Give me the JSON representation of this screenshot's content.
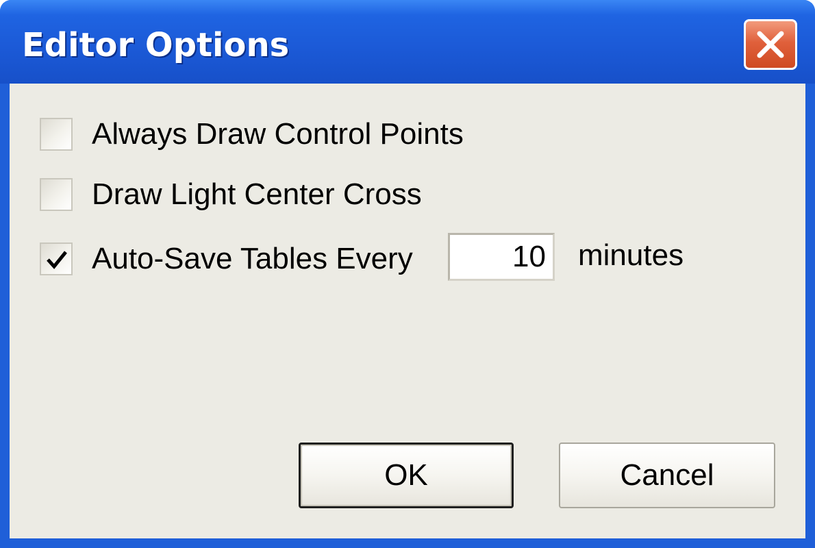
{
  "window": {
    "title": "Editor Options",
    "close_icon": "close-icon"
  },
  "options": [
    {
      "label": "Always Draw Control Points",
      "checked": false
    },
    {
      "label": "Draw Light Center Cross",
      "checked": false
    },
    {
      "label": "Auto-Save Tables Every",
      "checked": true
    }
  ],
  "autosave": {
    "value": "10",
    "unit_label": "minutes"
  },
  "buttons": {
    "ok_label": "OK",
    "cancel_label": "Cancel"
  },
  "colors": {
    "titlebar": "#1b59d6",
    "close_button": "#e0603b",
    "client_background": "#ecebe4"
  }
}
